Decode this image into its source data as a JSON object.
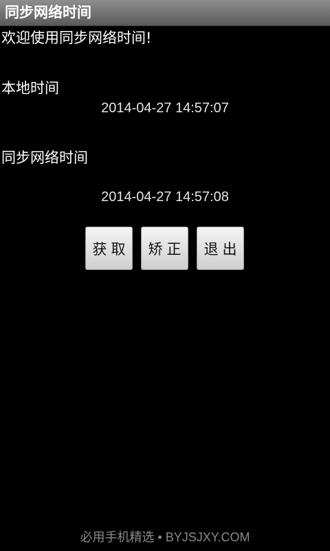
{
  "app": {
    "title": "同步网络时间"
  },
  "main": {
    "welcome": "欢迎使用同步网络时间!",
    "local_label": "本地时间",
    "local_time": "2014-04-27 14:57:07",
    "network_label": "同步网络时间",
    "network_time": "2014-04-27 14:57:08"
  },
  "buttons": {
    "fetch": "获取",
    "correct": "矫正",
    "exit": "退出"
  },
  "footer": {
    "watermark": "必用手机精选 • BYJSJXY.COM"
  }
}
